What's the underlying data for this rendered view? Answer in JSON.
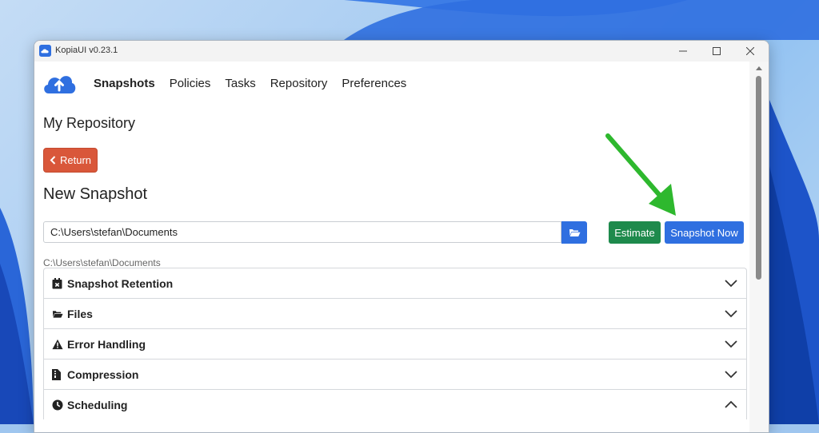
{
  "window": {
    "title": "KopiaUI v0.23.1"
  },
  "nav": {
    "items": [
      {
        "label": "Snapshots",
        "active": true
      },
      {
        "label": "Policies",
        "active": false
      },
      {
        "label": "Tasks",
        "active": false
      },
      {
        "label": "Repository",
        "active": false
      },
      {
        "label": "Preferences",
        "active": false
      }
    ]
  },
  "page": {
    "repo_title": "My Repository",
    "return_label": "Return",
    "title": "New Snapshot",
    "path_value": "C:\\Users\\stefan\\Documents",
    "path_label": "C:\\Users\\stefan\\Documents",
    "estimate_label": "Estimate",
    "snapshot_now_label": "Snapshot Now"
  },
  "sections": [
    {
      "label": "Snapshot Retention",
      "icon": "calendar-x-icon",
      "expanded": false
    },
    {
      "label": "Files",
      "icon": "folder-open-icon",
      "expanded": false
    },
    {
      "label": "Error Handling",
      "icon": "warning-triangle-icon",
      "expanded": false
    },
    {
      "label": "Compression",
      "icon": "file-archive-icon",
      "expanded": false
    },
    {
      "label": "Scheduling",
      "icon": "clock-icon",
      "expanded": true
    }
  ],
  "colors": {
    "return": "#d9573a",
    "primary": "#2f6fe0",
    "estimate": "#1e8a4c",
    "annotation_arrow": "#2eb82e"
  }
}
